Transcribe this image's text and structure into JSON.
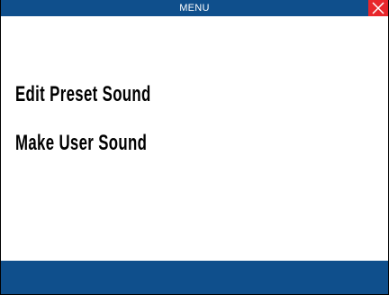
{
  "titlebar": {
    "title": "MENU",
    "close_icon": "close-icon",
    "close_color": "#e8262b",
    "bar_color": "#0f4f8c"
  },
  "menu": {
    "items": [
      {
        "label": "Edit  Preset  Sound"
      },
      {
        "label": "Make  User  Sound"
      }
    ]
  },
  "footer": {
    "color": "#0f4f8c"
  }
}
